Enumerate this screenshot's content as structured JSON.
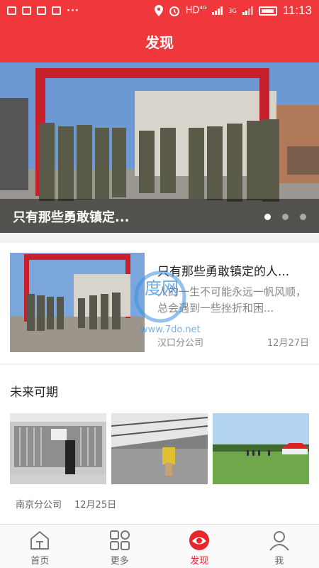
{
  "status_bar": {
    "network": "HD",
    "network_sup": "4G",
    "signal_2": "3G",
    "time": "11:13"
  },
  "header": {
    "title": "发现"
  },
  "banner": {
    "caption": "只有那些勇敢镇定...",
    "slide_count": 3,
    "active_slide": 1
  },
  "article": {
    "title": "只有那些勇敢镇定的人...",
    "summary": "人的一生不可能永远一帆风顺，总会遇到一些挫折和困...",
    "source": "汉口分公司",
    "date": "12月27日"
  },
  "album": {
    "title": "未来可期",
    "source": "南京分公司",
    "date": "12月25日"
  },
  "watermark": {
    "text": "度网",
    "url": "www.7do.net"
  },
  "nav": {
    "items": [
      {
        "label": "首页",
        "icon": "home-icon"
      },
      {
        "label": "更多",
        "icon": "grid-icon"
      },
      {
        "label": "发现",
        "icon": "eye-icon",
        "active": true
      },
      {
        "label": "我",
        "icon": "user-icon"
      }
    ]
  },
  "colors": {
    "accent": "#f0373b",
    "active_nav": "#e8262a"
  }
}
